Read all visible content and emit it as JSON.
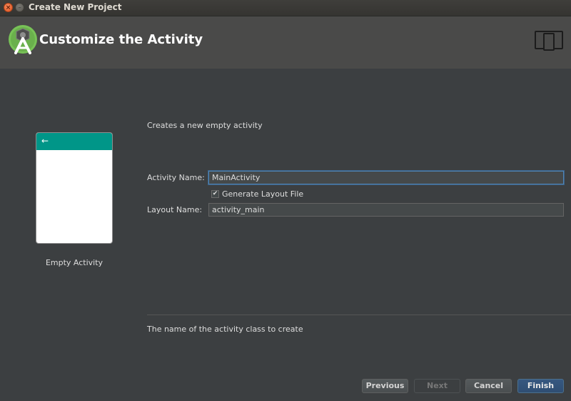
{
  "window": {
    "title": "Create New Project",
    "close_icon_glyph": "×",
    "minimize_icon_glyph": "–"
  },
  "header": {
    "title": "Customize the Activity",
    "logo_icon": "android-studio-logo-icon",
    "device_icon": "device-layout-icon",
    "accent_color": "#78c257"
  },
  "template": {
    "label": "Empty Activity",
    "back_arrow_glyph": "←",
    "appbar_color": "#009688"
  },
  "form": {
    "description": "Creates a new empty activity",
    "activity_name_label": "Activity Name:",
    "activity_name_value": "MainActivity",
    "generate_layout_label": "Generate Layout File",
    "generate_layout_checked": true,
    "check_glyph": "✔",
    "layout_name_label": "Layout Name:",
    "layout_name_value": "activity_main",
    "help_text": "The name of the activity class to create"
  },
  "buttons": {
    "previous": "Previous",
    "next": "Next",
    "cancel": "Cancel",
    "finish": "Finish"
  }
}
